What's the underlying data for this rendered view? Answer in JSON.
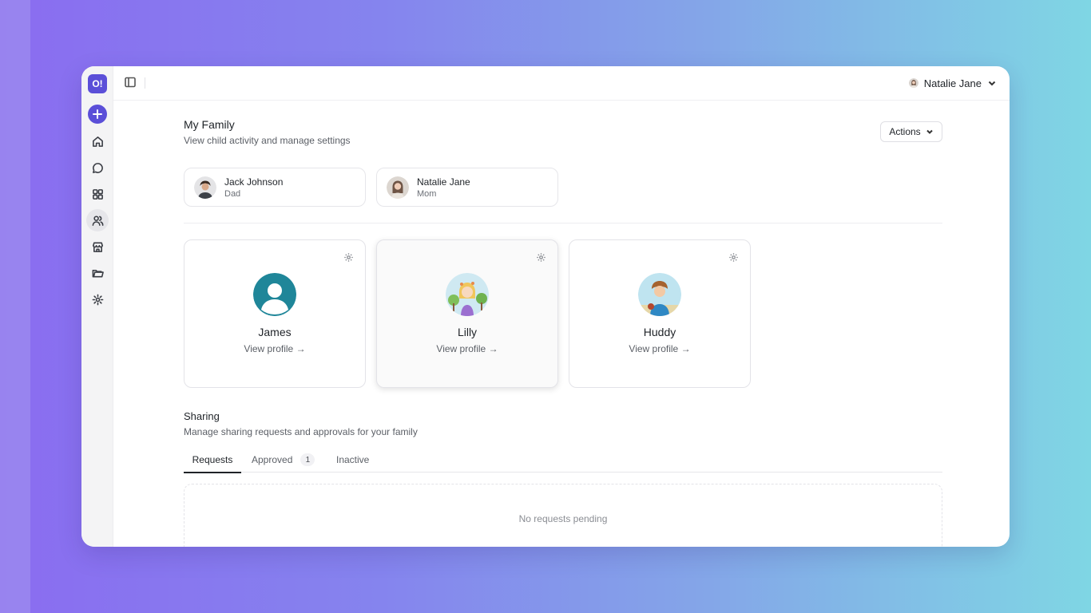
{
  "app": {
    "logo_text": "O!",
    "accent_color": "#5b4fd8"
  },
  "sidebar": {
    "items": [
      {
        "icon": "plus-icon"
      },
      {
        "icon": "home-icon"
      },
      {
        "icon": "chat-icon"
      },
      {
        "icon": "grid-icon"
      },
      {
        "icon": "users-icon",
        "active": true
      },
      {
        "icon": "store-icon"
      },
      {
        "icon": "folder-icon"
      },
      {
        "icon": "gear-icon"
      }
    ]
  },
  "topbar": {
    "user_name": "Natalie Jane"
  },
  "header": {
    "title": "My Family",
    "subtitle": "View child activity and manage settings",
    "actions_label": "Actions"
  },
  "parents": [
    {
      "name": "Jack Johnson",
      "role": "Dad"
    },
    {
      "name": "Natalie Jane",
      "role": "Mom"
    }
  ],
  "children": [
    {
      "name": "James",
      "link": "View profile →"
    },
    {
      "name": "Lilly",
      "link": "View profile →"
    },
    {
      "name": "Huddy",
      "link": "View profile →"
    }
  ],
  "sharing": {
    "title": "Sharing",
    "subtitle": "Manage sharing requests and approvals for your family",
    "tabs": [
      {
        "label": "Requests",
        "active": true
      },
      {
        "label": "Approved",
        "count": "1"
      },
      {
        "label": "Inactive"
      }
    ],
    "empty_text": "No requests pending"
  }
}
